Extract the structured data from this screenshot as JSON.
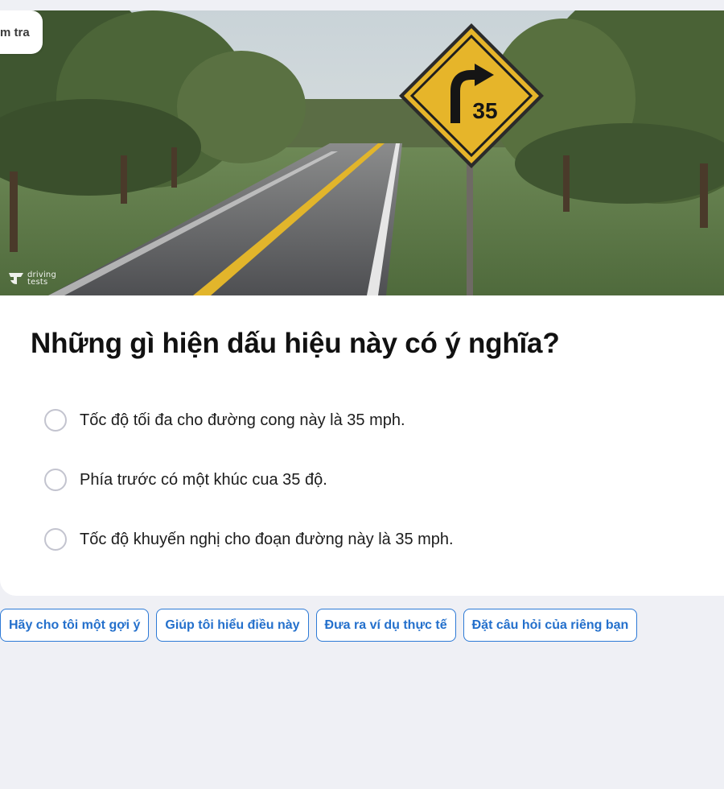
{
  "header": {
    "pill_label": "m tra"
  },
  "image": {
    "sign_number": "35",
    "watermark_line1": "driving",
    "watermark_line2": "tests"
  },
  "question": {
    "text": "Những gì hiện dấu hiệu này có ý nghĩa?"
  },
  "options": [
    {
      "label": "Tốc độ tối đa cho đường cong này là 35 mph."
    },
    {
      "label": "Phía trước có một khúc cua 35 độ."
    },
    {
      "label": "Tốc độ khuyến nghị cho đoạn đường này là 35 mph."
    }
  ],
  "actions": [
    {
      "label": "Hãy cho tôi một gợi ý"
    },
    {
      "label": "Giúp tôi hiểu điều này"
    },
    {
      "label": "Đưa ra ví dụ thực tế"
    },
    {
      "label": "Đặt câu hỏi của riêng bạn"
    }
  ],
  "colors": {
    "page_background": "#eff0f5",
    "accent": "#2470cc",
    "sign_yellow": "#e6b52a",
    "radio_border": "#c3c4cf"
  }
}
